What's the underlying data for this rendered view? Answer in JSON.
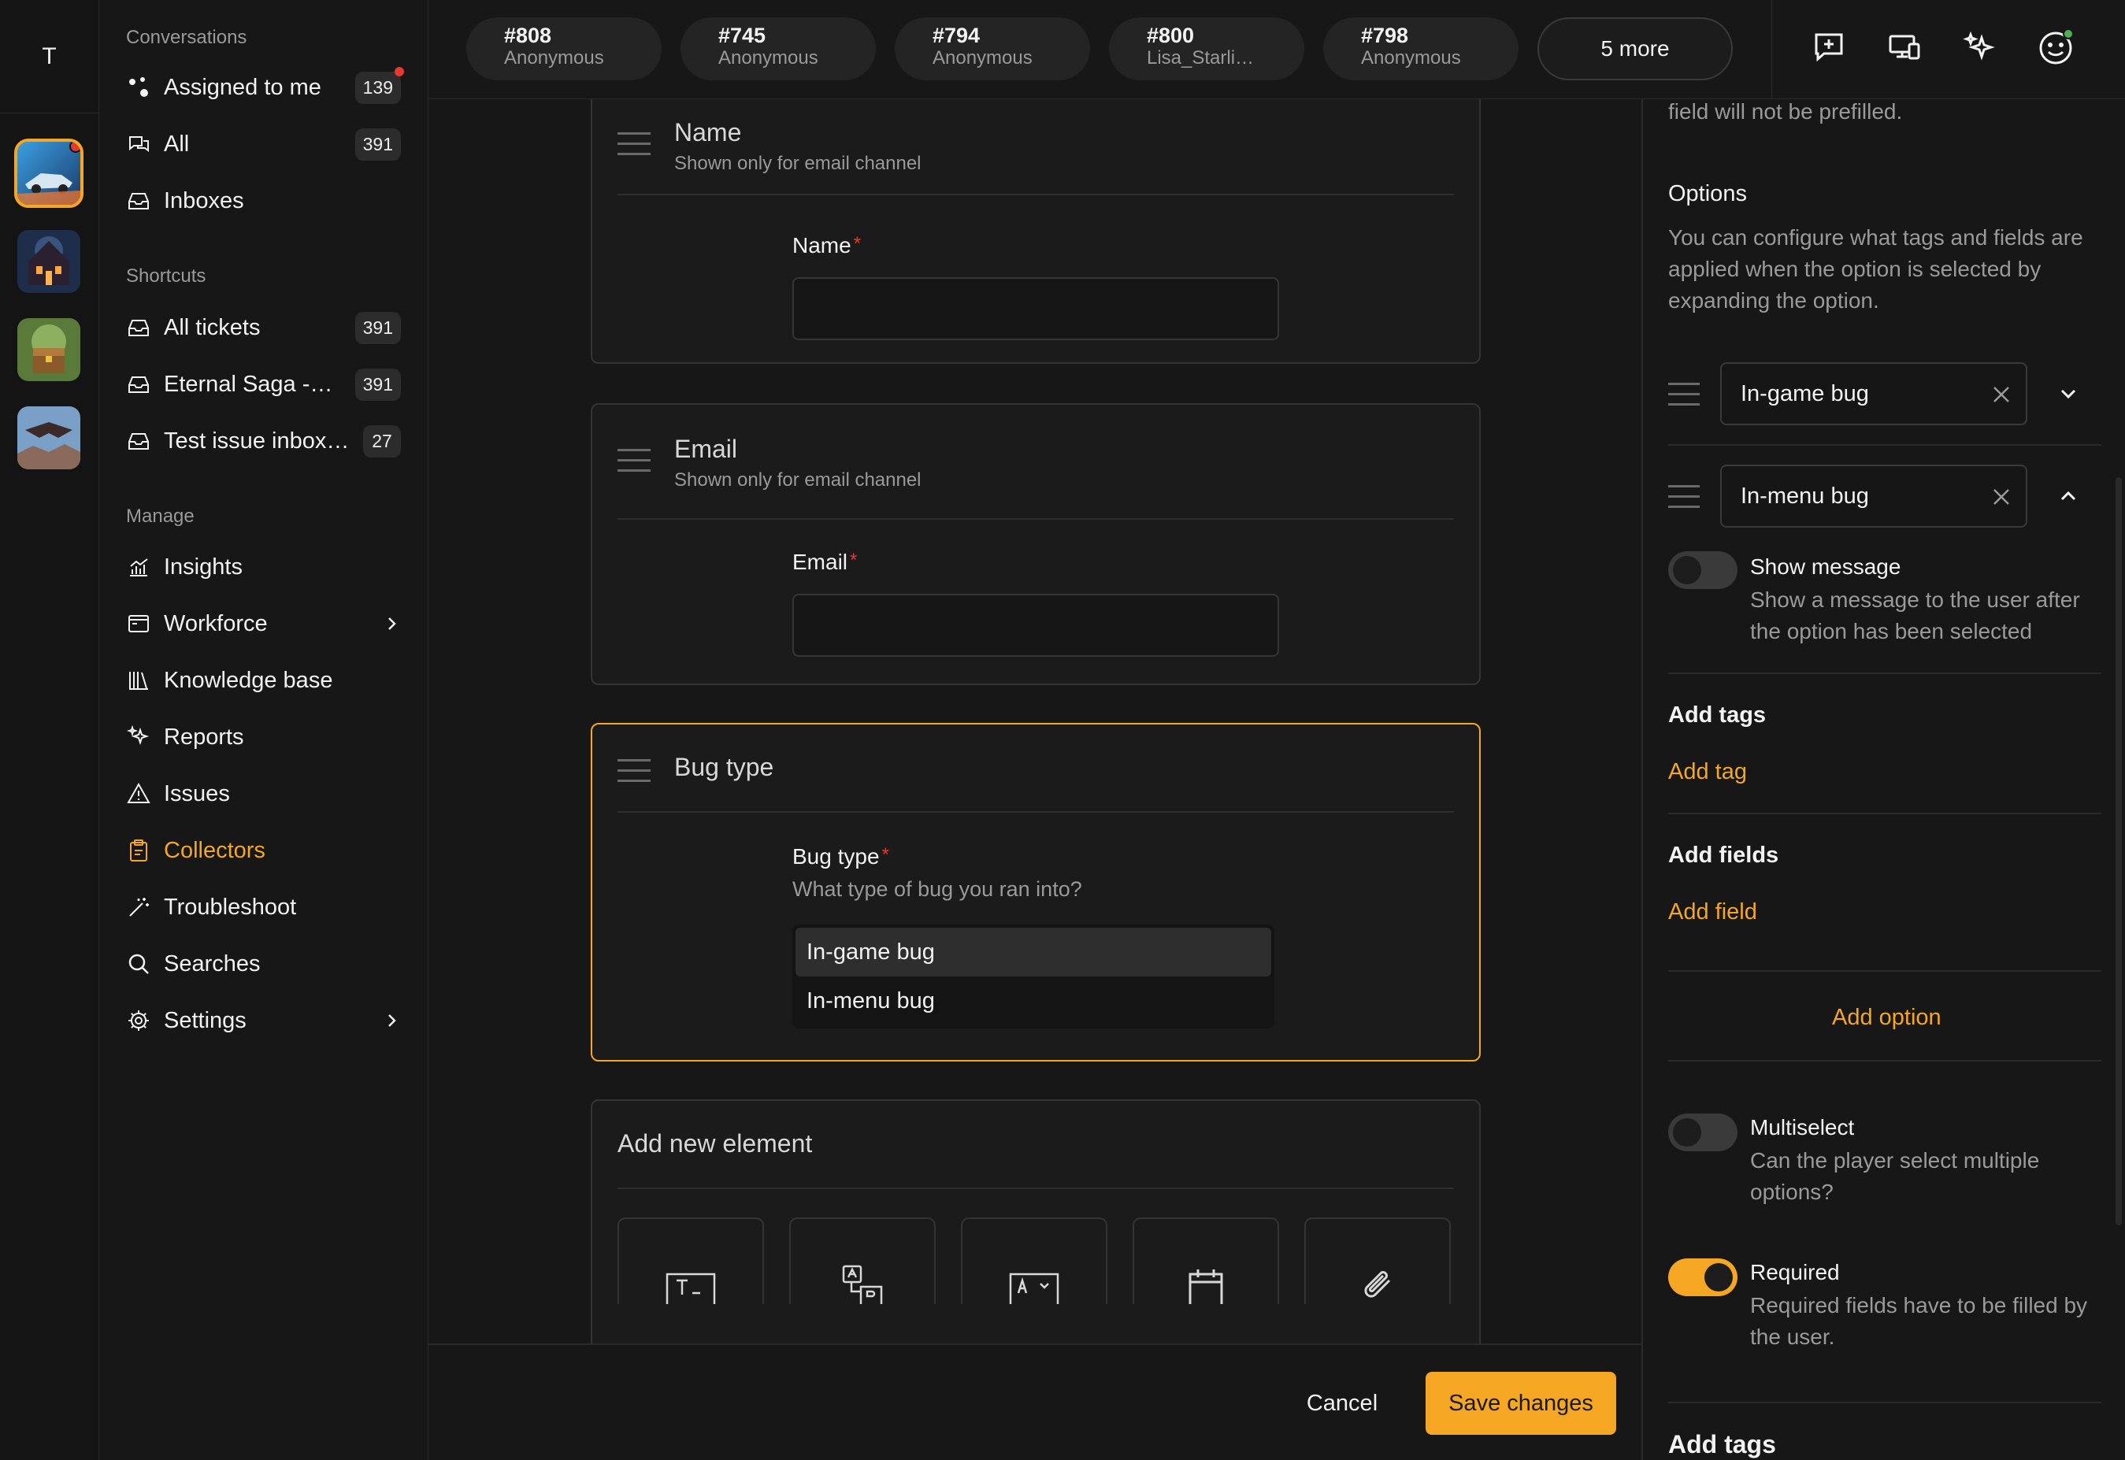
{
  "rail": {
    "initial": "T"
  },
  "sidebar": {
    "conversations_title": "Conversations",
    "assigned": {
      "label": "Assigned to me",
      "count": "139"
    },
    "all": {
      "label": "All",
      "count": "391"
    },
    "inboxes": {
      "label": "Inboxes"
    },
    "shortcuts_title": "Shortcuts",
    "shortcuts": [
      {
        "label": "All tickets",
        "count": "391"
      },
      {
        "label": "Eternal Saga -…",
        "count": "391"
      },
      {
        "label": "Test issue inbox…",
        "count": "27"
      }
    ],
    "manage_title": "Manage",
    "manage": [
      {
        "label": "Insights"
      },
      {
        "label": "Workforce"
      },
      {
        "label": "Knowledge base"
      },
      {
        "label": "Reports"
      },
      {
        "label": "Issues"
      },
      {
        "label": "Collectors"
      },
      {
        "label": "Troubleshoot"
      },
      {
        "label": "Searches"
      },
      {
        "label": "Settings"
      }
    ]
  },
  "tabs": [
    {
      "num": "#808",
      "sub": "Anonymous"
    },
    {
      "num": "#745",
      "sub": "Anonymous"
    },
    {
      "num": "#794",
      "sub": "Anonymous"
    },
    {
      "num": "#800",
      "sub": "Lisa_Starli…"
    },
    {
      "num": "#798",
      "sub": "Anonymous"
    }
  ],
  "more_tabs": "5 more",
  "form": {
    "name_card": {
      "title": "Name",
      "subtitle": "Shown only for email channel",
      "field_label": "Name"
    },
    "email_card": {
      "title": "Email",
      "subtitle": "Shown only for email channel",
      "field_label": "Email"
    },
    "bug_card": {
      "title": "Bug type",
      "field_label": "Bug type",
      "hint": "What type of bug you ran into?",
      "options": [
        "In-game bug",
        "In-menu bug"
      ]
    },
    "add_element": {
      "title": "Add new element"
    },
    "required_mark": "*"
  },
  "footer": {
    "cancel": "Cancel",
    "save": "Save changes"
  },
  "panel": {
    "prefill_note": "field will not be prefilled.",
    "options_title": "Options",
    "options_desc": "You can configure what tags and fields are applied when the option is selected by expanding the option.",
    "option_1": "In-game bug",
    "option_2": "In-menu bug",
    "show_message": {
      "title": "Show message",
      "desc": "Show a message to the user after the option has been selected"
    },
    "add_tags_title": "Add tags",
    "add_tag_link": "Add tag",
    "add_fields_title": "Add fields",
    "add_field_link": "Add field",
    "add_option": "Add option",
    "multiselect": {
      "title": "Multiselect",
      "desc": "Can the player select multiple options?",
      "on": false
    },
    "required": {
      "title": "Required",
      "desc": "Required fields have to be filled by the user.",
      "on": true
    },
    "add_tags_bottom": "Add tags"
  },
  "colors": {
    "accent": "#f5a623",
    "required": "#e53935",
    "online": "#4caf50"
  }
}
